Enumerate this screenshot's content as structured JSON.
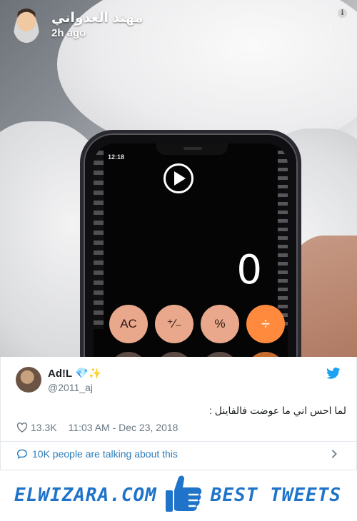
{
  "snap": {
    "user_name": "مهند العدواني",
    "time_ago": "2h ago",
    "info_glyph": "i",
    "more_glyph": "⋮"
  },
  "phone_screen": {
    "status_time": "12:18",
    "display_value": "0",
    "buttons": [
      "AC",
      "⁺∕₋",
      "%",
      "÷"
    ]
  },
  "tweet": {
    "display_name": "Ad!L 💎✨",
    "handle": "@2011_aj",
    "text": "لما احس اني ما عوضت فالفاينل :",
    "likes": "13.3K",
    "timestamp": "11:03 AM - Dec 23, 2018",
    "talking": "10K people are talking about this"
  },
  "banner": {
    "left_text": "ELWIZARA.COM",
    "right_text": "BEST TWEETS"
  },
  "colors": {
    "twitter_blue": "#1da1f2",
    "link_blue": "#2b7bb9",
    "brand_blue": "#1f73c9",
    "text_gray": "#697882"
  },
  "icons": [
    "info-icon",
    "more-icon",
    "play-icon",
    "twitter-bird-icon",
    "heart-icon",
    "speech-bubble-icon",
    "chevron-right-icon",
    "thumbs-up-icon"
  ]
}
